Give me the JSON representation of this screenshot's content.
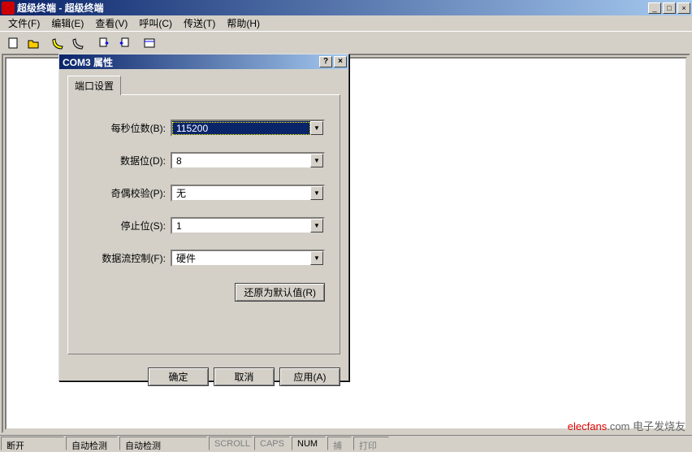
{
  "window": {
    "title": "超级终端 - 超级终端"
  },
  "menu": {
    "file": "文件(F)",
    "edit": "编辑(E)",
    "view": "查看(V)",
    "call": "呼叫(C)",
    "transfer": "传送(T)",
    "help": "帮助(H)"
  },
  "dialog": {
    "title": "COM3 属性",
    "tab": "端口设置",
    "fields": {
      "baud_label": "每秒位数(B):",
      "baud_value": "115200",
      "databits_label": "数据位(D):",
      "databits_value": "8",
      "parity_label": "奇偶校验(P):",
      "parity_value": "无",
      "stopbits_label": "停止位(S):",
      "stopbits_value": "1",
      "flow_label": "数据流控制(F):",
      "flow_value": "硬件"
    },
    "restore": "还原为默认值(R)",
    "ok": "确定",
    "cancel": "取消",
    "apply": "应用(A)"
  },
  "status": {
    "conn": "断开",
    "detect1": "自动检测",
    "detect2": "自动检测",
    "scroll": "SCROLL",
    "caps": "CAPS",
    "num": "NUM",
    "capture": "捕",
    "print": "打印"
  },
  "watermark": {
    "brand": "elecfans",
    "suffix": ".com 电子发烧友"
  }
}
